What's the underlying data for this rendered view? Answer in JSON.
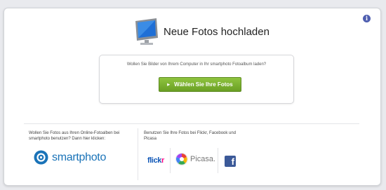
{
  "header": {
    "title": "Neue Fotos hochladen",
    "info_icon": "i"
  },
  "upload": {
    "prompt": "Wollen Sie Bilder von Ihrem Computer in Ihr smartphoto Fotoalbum laden?",
    "button_label": "Wählen Sie Ihre Fotos",
    "button_color": "#7cb332"
  },
  "online_albums": {
    "text": "Wollen Sie Fotos aus Ihren Online-Fotoalben bei smartphoto benutzen? Dann hier klicken:",
    "logo_text": "smartphoto",
    "brand_color": "#1a73b8"
  },
  "partners": {
    "text": "Benutzen Sie Ihre Fotos bei Flickr, Facebook und Picasa",
    "flickr_part1": "flick",
    "flickr_part2": "r",
    "picasa": "Picasa.",
    "facebook": "f"
  },
  "icons": {
    "monitor": "monitor-icon",
    "info": "info-icon",
    "smartphoto": "smartphoto-logo-icon",
    "picasa": "picasa-icon",
    "facebook": "facebook-icon"
  }
}
